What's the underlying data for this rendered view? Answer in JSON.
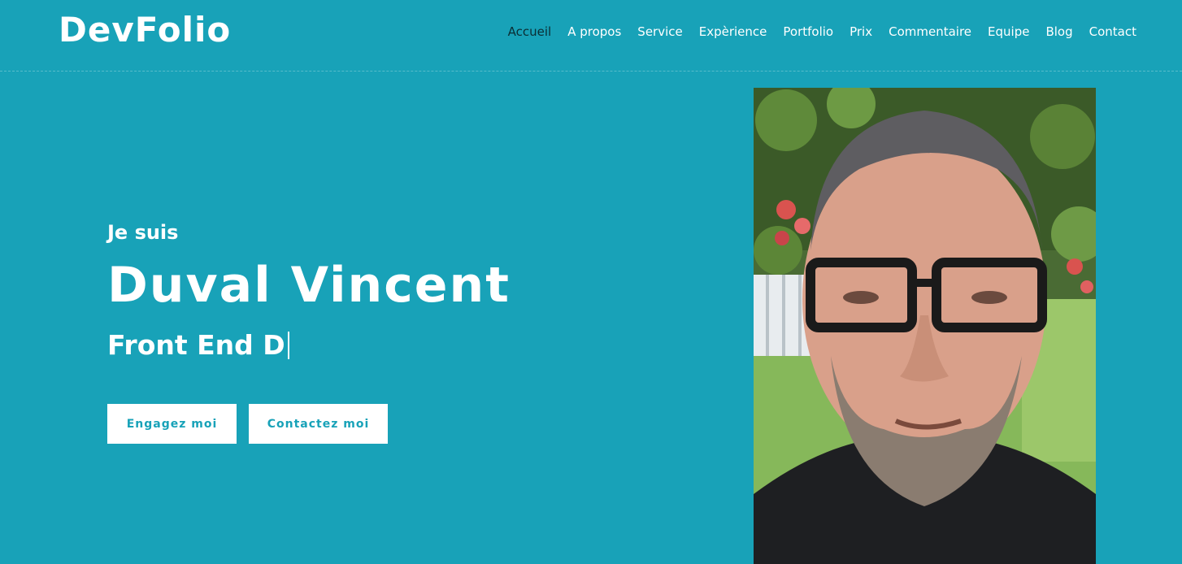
{
  "brand": "DevFolio",
  "nav": {
    "items": [
      "Accueil",
      "A propos",
      "Service",
      "Expèrience",
      "Portfolio",
      "Prix",
      "Commentaire",
      "Equipe",
      "Blog",
      "Contact"
    ],
    "active": "Accueil"
  },
  "hero": {
    "pre": "Je suis",
    "name": "Duval Vincent",
    "role": "Front End D",
    "buttons": {
      "hire": "Engagez moi",
      "contact": "Contactez moi"
    }
  },
  "colors": {
    "background": "#18a2b8",
    "button_bg": "#ffffff",
    "button_text": "#18a2b8",
    "active_nav": "#0b2d33"
  },
  "icons": {
    "typing_caret": "text-cursor"
  }
}
